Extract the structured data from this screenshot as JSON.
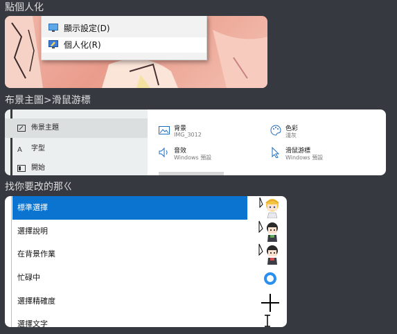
{
  "sections": [
    {
      "heading": "點個人化"
    },
    {
      "heading": "布景主圖>滑鼠游標"
    },
    {
      "heading": "找你要改的那ㄍ"
    }
  ],
  "context_menu": {
    "items": [
      {
        "label": "顯示設定(D)",
        "icon": "display-icon"
      },
      {
        "label": "個人化(R)",
        "icon": "personalize-icon",
        "highlighted": true
      }
    ]
  },
  "settings": {
    "sidebar": [
      {
        "label": "佈景主題",
        "icon": "theme-icon",
        "selected": true
      },
      {
        "label": "字型",
        "icon": "font-icon"
      },
      {
        "label": "開始",
        "icon": "start-icon"
      }
    ],
    "cells": [
      {
        "title": "背景",
        "sub": "IMG_3012",
        "icon": "picture-icon"
      },
      {
        "title": "色彩",
        "sub": "淺灰",
        "icon": "palette-icon"
      },
      {
        "title": "音效",
        "sub": "Windows 預設",
        "icon": "sound-icon"
      },
      {
        "title": "滑鼠游標",
        "sub": "Windows 預設",
        "icon": "cursor-icon"
      }
    ]
  },
  "cursor_list": {
    "rows": [
      {
        "label": "標準選擇",
        "selected": true,
        "icon": "anime-girl-blonde-cursor-icon"
      },
      {
        "label": "選擇說明",
        "icon": "anime-girl-dark-cursor-icon"
      },
      {
        "label": "在背景作業",
        "icon": "anime-girl-dark-cursor-icon"
      },
      {
        "label": "忙碌中",
        "icon": "busy-ring-icon"
      },
      {
        "label": "選擇精確度",
        "icon": "crosshair-icon"
      },
      {
        "label": "選擇文字",
        "icon": "text-beam-icon"
      }
    ]
  },
  "colors": {
    "background": "#36393f",
    "heading_text": "#dcddde",
    "selection_blue": "#0a74d0",
    "art_pink": "#ea9c8c"
  }
}
